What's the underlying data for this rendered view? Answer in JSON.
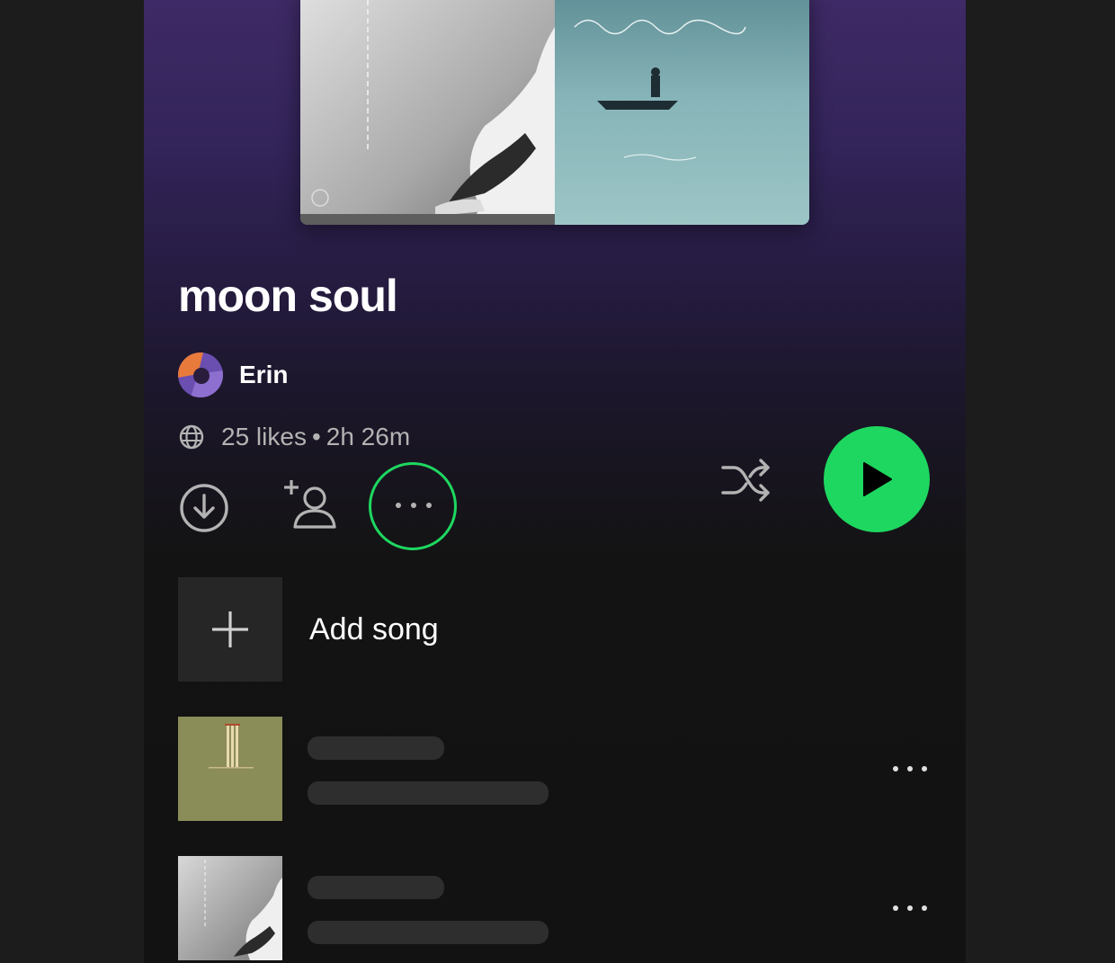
{
  "playlist": {
    "title": "moon soul",
    "owner": "Erin",
    "likes": "25 likes",
    "separator": "•",
    "duration": "2h 26m"
  },
  "icons": {
    "visibility": "globe-icon",
    "download": "download-icon",
    "add_collaborator": "add-person-icon",
    "more": "more-options-icon",
    "shuffle": "shuffle-icon",
    "play": "play-icon",
    "add": "plus-icon"
  },
  "actions": {
    "add_song_label": "Add song"
  },
  "colors": {
    "accent": "#1ed760",
    "header_gradient_top": "#3e2a66",
    "background": "#121212",
    "skeleton": "#2e2e2e"
  },
  "tracks": [
    {
      "art": "olive-wicket-artwork",
      "loading": true
    },
    {
      "art": "grey-figure-artwork",
      "loading": true
    }
  ]
}
